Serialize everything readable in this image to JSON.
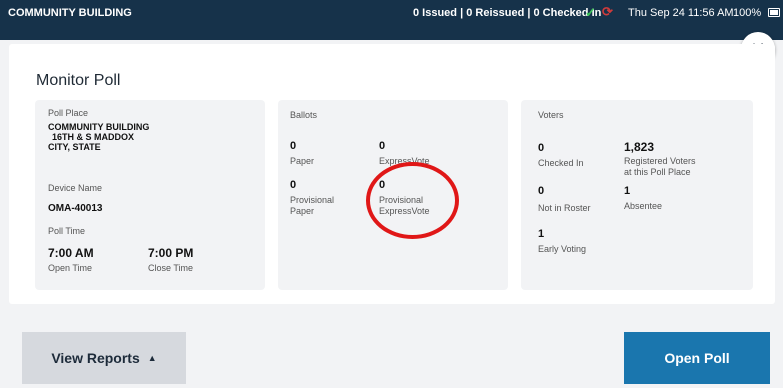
{
  "status_bar": {
    "site_name": "COMMUNITY BUILDING",
    "counts": "0 Issued | 0 Reissued | 0 Checked In",
    "datetime": "Thu Sep 24  11:56 AM",
    "battery": "100%"
  },
  "dialog": {
    "title": "Monitor Poll",
    "close_glyph": "✕"
  },
  "poll_place": {
    "heading": "Poll Place",
    "address_line1": "COMMUNITY BUILDING",
    "address_line2": "16TH & S MADDOX",
    "address_line3": "CITY, STATE",
    "device_label": "Device Name",
    "device_value": "OMA-40013",
    "poll_time_label": "Poll Time",
    "open_time": "7:00 AM",
    "open_time_label": "Open Time",
    "close_time": "7:00 PM",
    "close_time_label": "Close Time"
  },
  "ballots": {
    "heading": "Ballots",
    "paper_value": "0",
    "paper_label": "Paper",
    "expressvote_value": "0",
    "expressvote_label": "ExpressVote",
    "prov_paper_value": "0",
    "prov_paper_label1": "Provisional",
    "prov_paper_label2": "Paper",
    "prov_express_value": "0",
    "prov_express_label1": "Provisional",
    "prov_express_label2": "ExpressVote"
  },
  "voters": {
    "heading": "Voters",
    "checked_in_value": "0",
    "checked_in_label": "Checked In",
    "registered_value": "1,823",
    "registered_label1": "Registered Voters",
    "registered_label2": "at this Poll Place",
    "not_in_roster_value": "0",
    "not_in_roster_label": "Not in Roster",
    "absentee_value": "1",
    "absentee_label": "Absentee",
    "early_value": "1",
    "early_label": "Early Voting"
  },
  "actions": {
    "view_reports": "View Reports",
    "view_reports_caret": "▲",
    "open_poll": "Open Poll"
  },
  "colors": {
    "header_bg": "#16324a",
    "primary_button": "#1a76ae",
    "annotation_circle": "#e01717"
  }
}
